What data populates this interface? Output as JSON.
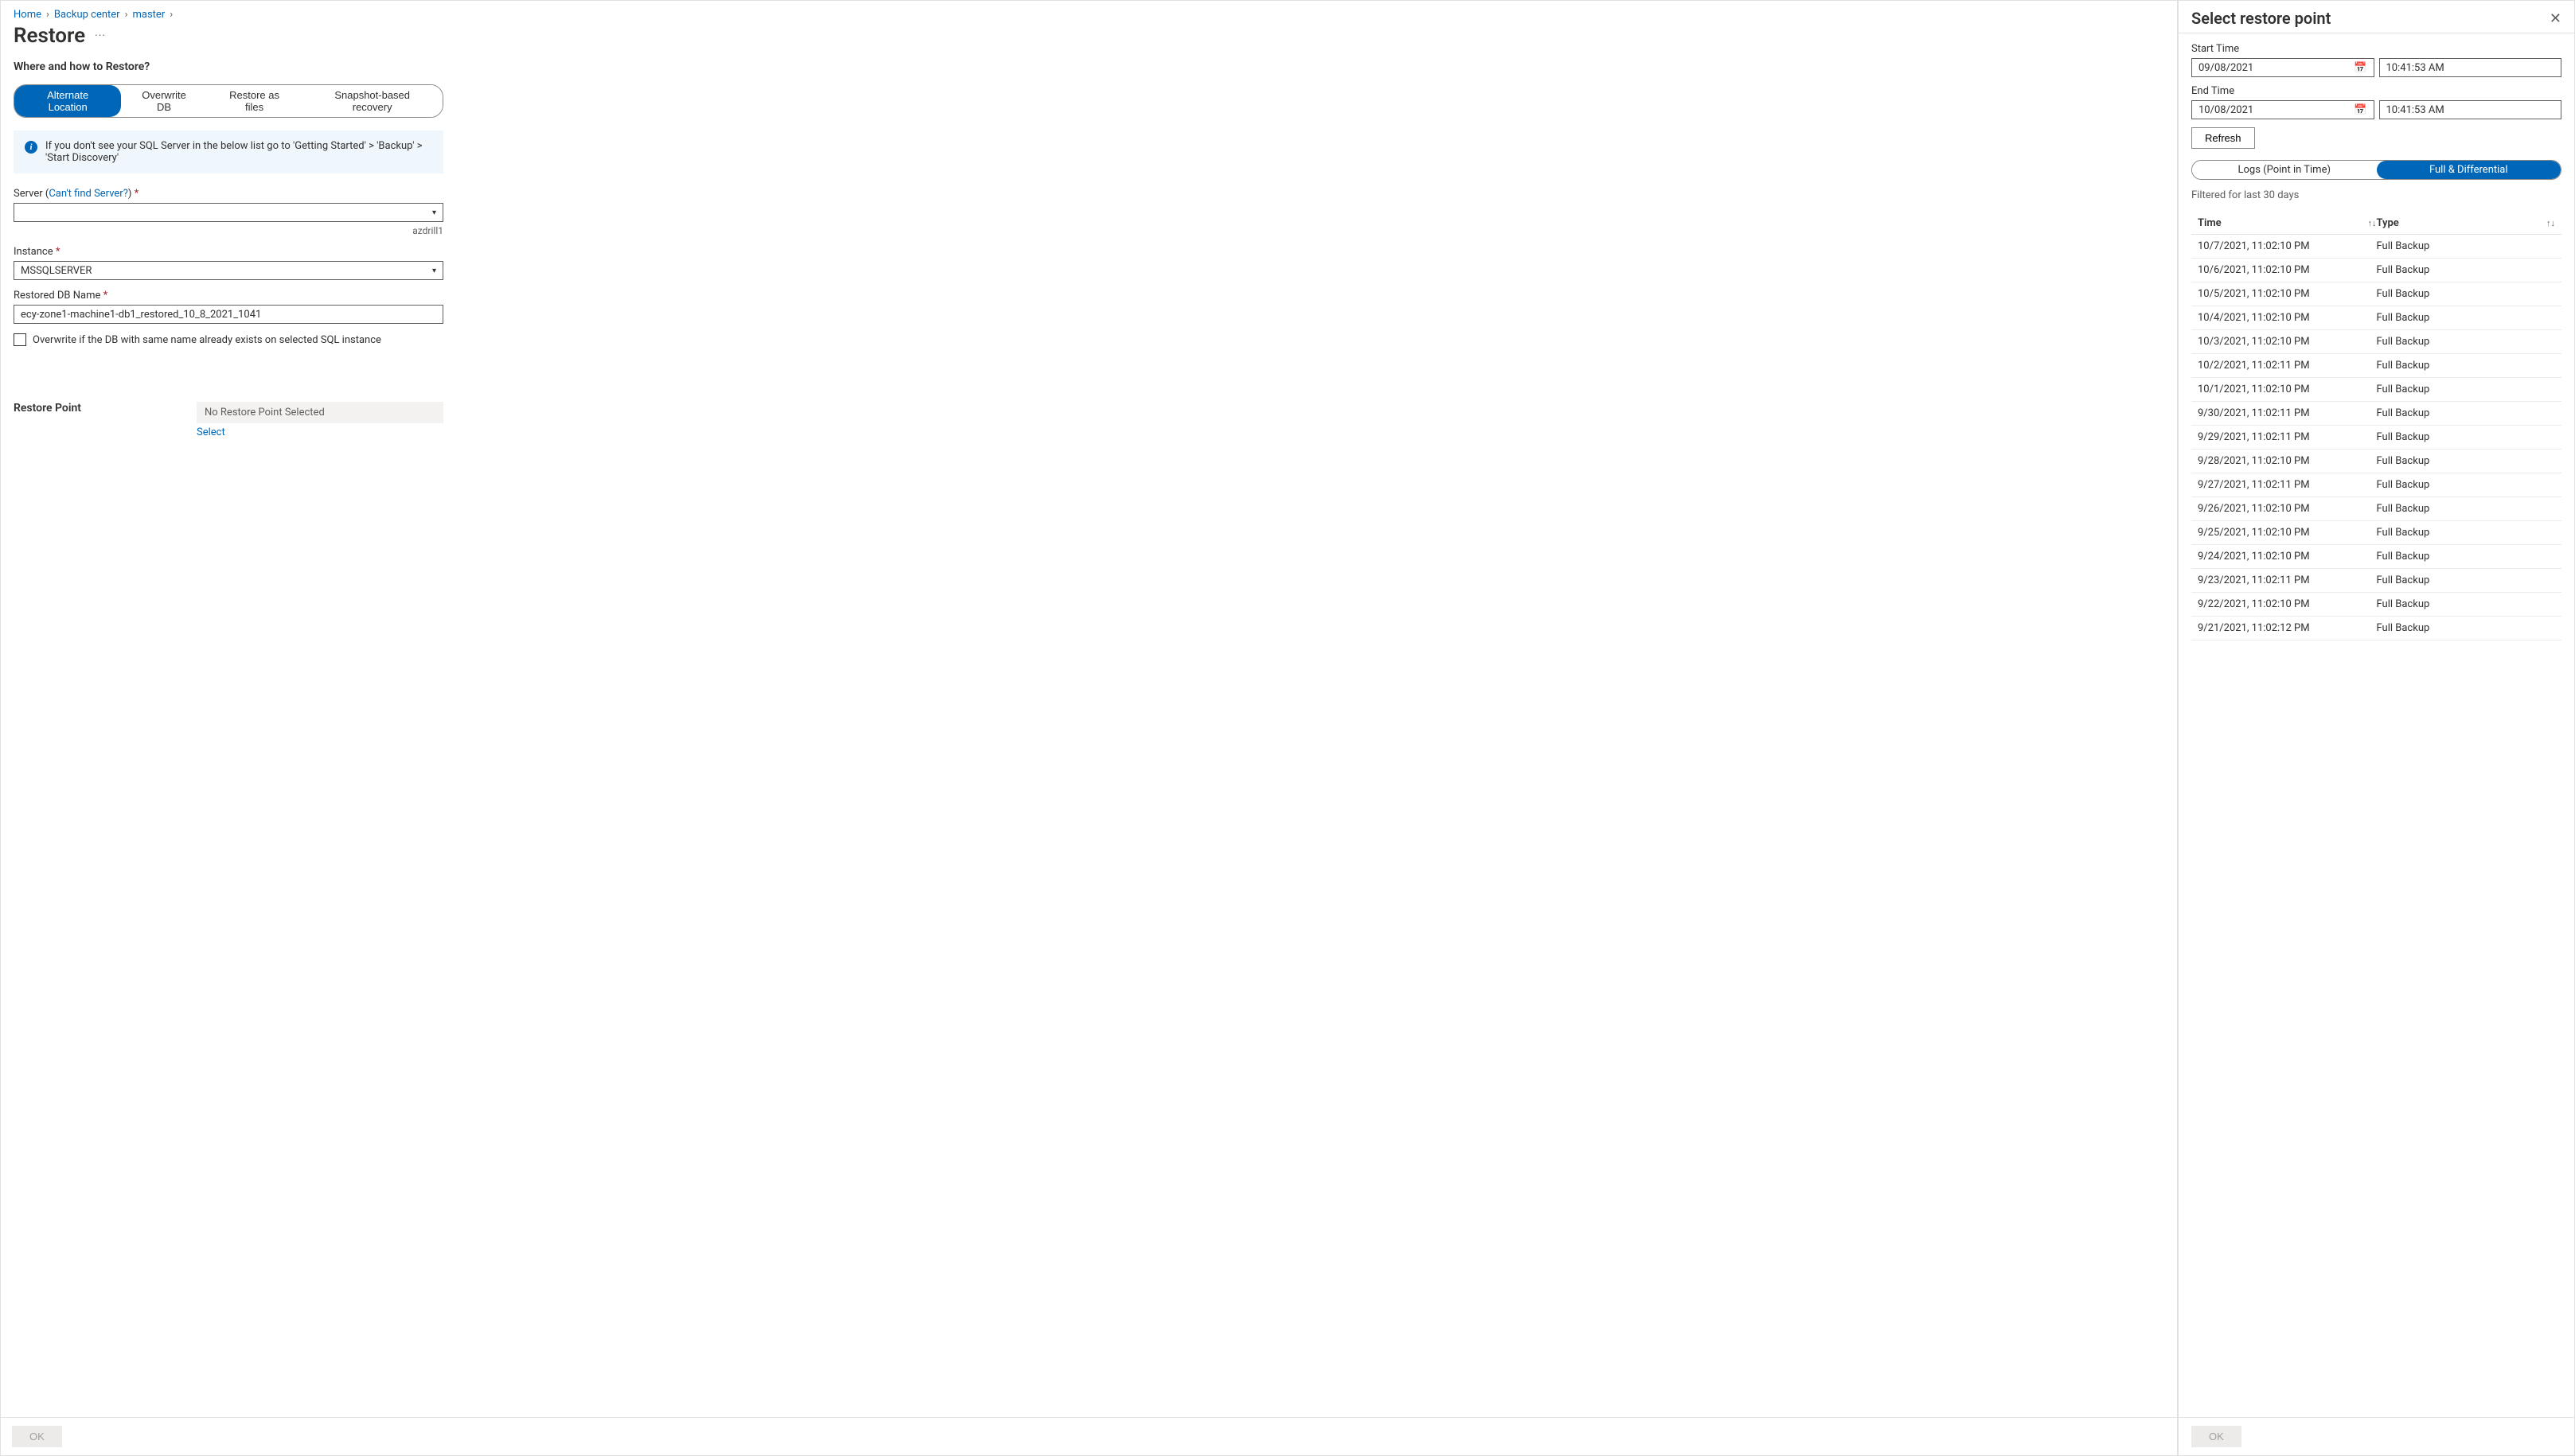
{
  "breadcrumb": {
    "home": "Home",
    "backup_center": "Backup center",
    "master": "master"
  },
  "page": {
    "title": "Restore"
  },
  "section": {
    "where_heading": "Where and how to Restore?"
  },
  "restore_mode_tabs": {
    "alternate": "Alternate Location",
    "overwrite": "Overwrite DB",
    "files": "Restore as files",
    "snapshot": "Snapshot-based recovery"
  },
  "info_banner": "If you don't see your SQL Server in the below list go to 'Getting Started' > 'Backup' > 'Start Discovery'",
  "server_field": {
    "label": "Server (",
    "helper": "Can't find Server?",
    "label_close": ") ",
    "value": "",
    "hint": "azdrill1"
  },
  "instance_field": {
    "label": "Instance ",
    "value": "MSSQLSERVER"
  },
  "dbname_field": {
    "label": "Restored DB Name ",
    "value": "ecy-zone1-machine1-db1_restored_10_8_2021_1041"
  },
  "overwrite_checkbox": {
    "label": "Overwrite if the DB with same name already exists on selected SQL instance"
  },
  "restore_point": {
    "label": "Restore Point",
    "value": "No Restore Point Selected",
    "select": "Select"
  },
  "footer": {
    "ok": "OK"
  },
  "side": {
    "title": "Select restore point",
    "start_label": "Start Time",
    "start_date": "09/08/2021",
    "start_time": "10:41:53 AM",
    "end_label": "End Time",
    "end_date": "10/08/2021",
    "end_time": "10:41:53 AM",
    "refresh": "Refresh",
    "tab_logs": "Logs (Point in Time)",
    "tab_full": "Full & Differential",
    "filter_text": "Filtered for last 30 days",
    "th_time": "Time",
    "th_type": "Type",
    "ok": "OK",
    "rows": [
      {
        "time": "10/7/2021, 11:02:10 PM",
        "type": "Full Backup"
      },
      {
        "time": "10/6/2021, 11:02:10 PM",
        "type": "Full Backup"
      },
      {
        "time": "10/5/2021, 11:02:10 PM",
        "type": "Full Backup"
      },
      {
        "time": "10/4/2021, 11:02:10 PM",
        "type": "Full Backup"
      },
      {
        "time": "10/3/2021, 11:02:10 PM",
        "type": "Full Backup"
      },
      {
        "time": "10/2/2021, 11:02:11 PM",
        "type": "Full Backup"
      },
      {
        "time": "10/1/2021, 11:02:10 PM",
        "type": "Full Backup"
      },
      {
        "time": "9/30/2021, 11:02:11 PM",
        "type": "Full Backup"
      },
      {
        "time": "9/29/2021, 11:02:11 PM",
        "type": "Full Backup"
      },
      {
        "time": "9/28/2021, 11:02:10 PM",
        "type": "Full Backup"
      },
      {
        "time": "9/27/2021, 11:02:11 PM",
        "type": "Full Backup"
      },
      {
        "time": "9/26/2021, 11:02:10 PM",
        "type": "Full Backup"
      },
      {
        "time": "9/25/2021, 11:02:10 PM",
        "type": "Full Backup"
      },
      {
        "time": "9/24/2021, 11:02:10 PM",
        "type": "Full Backup"
      },
      {
        "time": "9/23/2021, 11:02:11 PM",
        "type": "Full Backup"
      },
      {
        "time": "9/22/2021, 11:02:10 PM",
        "type": "Full Backup"
      },
      {
        "time": "9/21/2021, 11:02:12 PM",
        "type": "Full Backup"
      }
    ]
  }
}
